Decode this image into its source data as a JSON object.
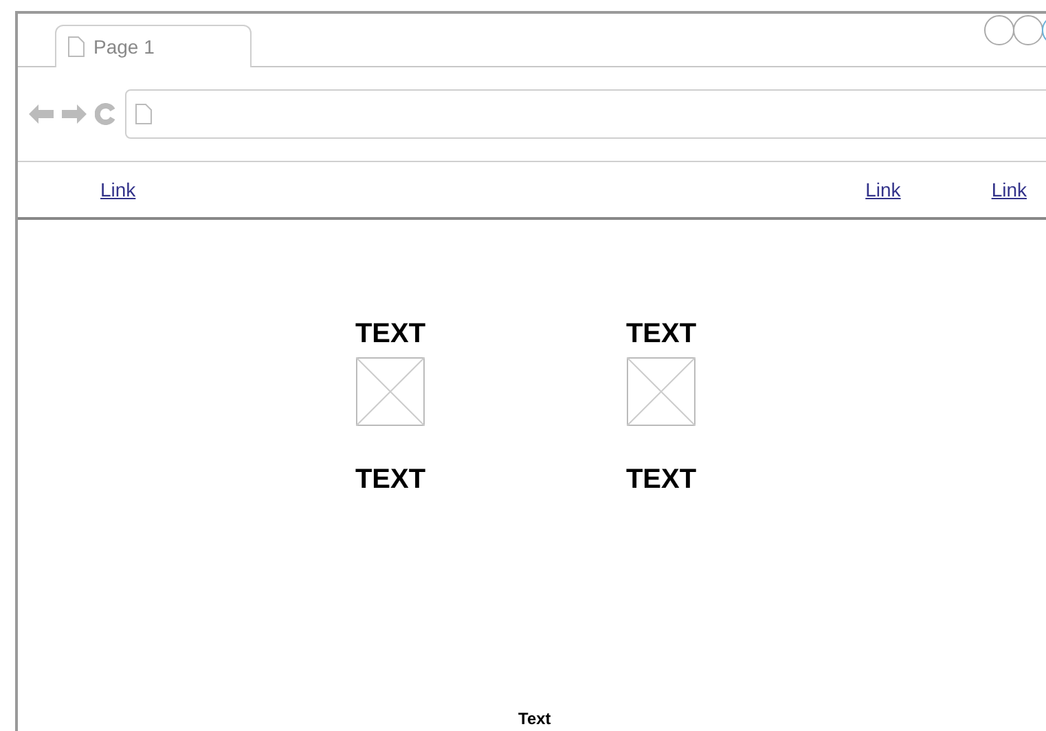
{
  "tabs": [
    {
      "label": "Page 1",
      "selected": true
    }
  ],
  "nav": {
    "left_links": [
      {
        "label": "Link"
      }
    ],
    "right_links": [
      {
        "label": "Link"
      },
      {
        "label": "Link"
      }
    ]
  },
  "items": [
    {
      "heading": "TEXT",
      "caption": "TEXT"
    },
    {
      "heading": "TEXT",
      "caption": "TEXT"
    }
  ],
  "footer": {
    "text": "Text"
  }
}
